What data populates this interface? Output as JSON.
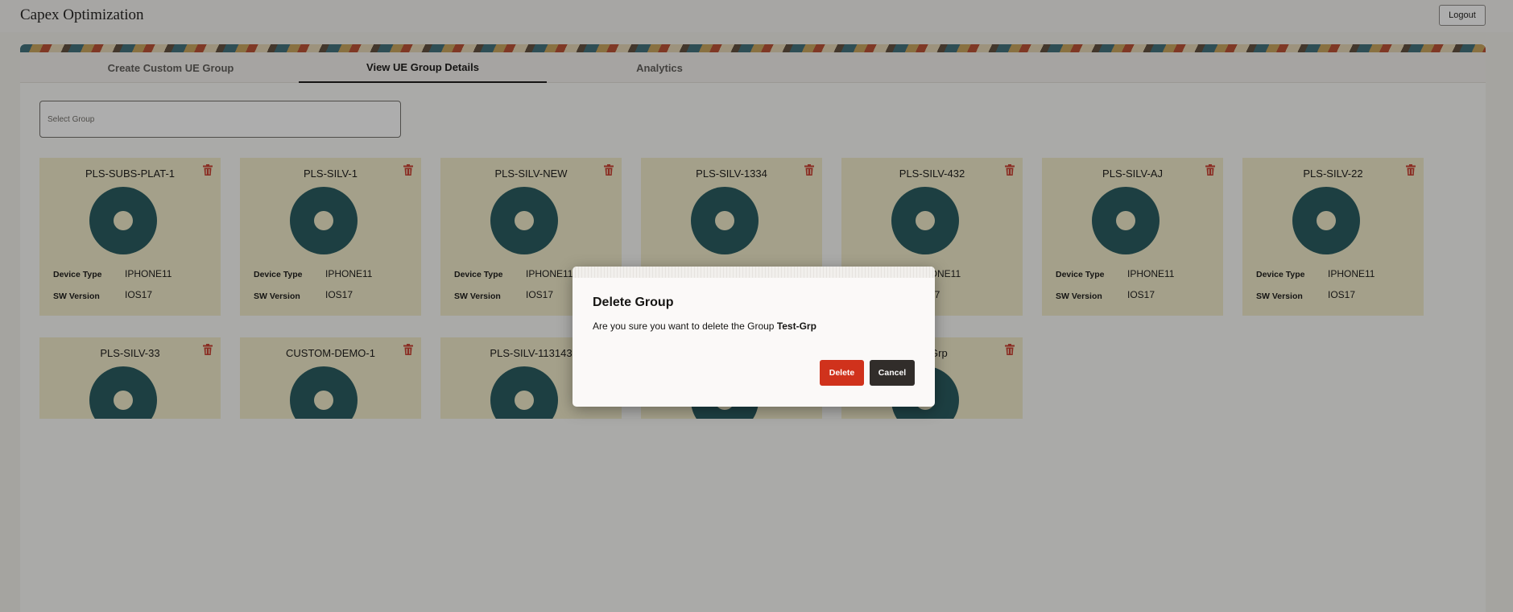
{
  "app": {
    "title": "Capex Optimization",
    "logout_label": "Logout"
  },
  "tabs": [
    {
      "label": "Create Custom UE Group"
    },
    {
      "label": "View UE Group Details"
    },
    {
      "label": "Analytics"
    }
  ],
  "group_select": {
    "placeholder": "Select Group"
  },
  "field_labels": {
    "device_type": "Device Type",
    "sw_version": "SW Version"
  },
  "groups": [
    {
      "name": "PLS-SUBS-PLAT-1",
      "device_type": "IPHONE11",
      "sw_version": "IOS17"
    },
    {
      "name": "PLS-SILV-1",
      "device_type": "IPHONE11",
      "sw_version": "IOS17"
    },
    {
      "name": "PLS-SILV-NEW",
      "device_type": "IPHONE11",
      "sw_version": "IOS17"
    },
    {
      "name": "PLS-SILV-1334",
      "device_type": "",
      "sw_version": ""
    },
    {
      "name": "PLS-SILV-432",
      "device_type": "HONE11",
      "sw_version": "S17"
    },
    {
      "name": "PLS-SILV-AJ",
      "device_type": "IPHONE11",
      "sw_version": "IOS17"
    },
    {
      "name": "PLS-SILV-22",
      "device_type": "IPHONE11",
      "sw_version": "IOS17"
    },
    {
      "name": "PLS-SILV-33"
    },
    {
      "name": "CUSTOM-DEMO-1"
    },
    {
      "name": "PLS-SILV-113143"
    },
    {
      "name": ""
    },
    {
      "name": "Grp"
    }
  ],
  "icons": {
    "delete": "trash-icon",
    "chart": "donut-chart"
  },
  "colors": {
    "card_bg": "#f1ecca",
    "donut": "#22575b",
    "danger": "#d0321c",
    "trash": "#c93b2b"
  },
  "dialog": {
    "title": "Delete Group",
    "message_prefix": "Are you sure you want to delete the Group ",
    "group_name": "Test-Grp",
    "delete_label": "Delete",
    "cancel_label": "Cancel"
  }
}
